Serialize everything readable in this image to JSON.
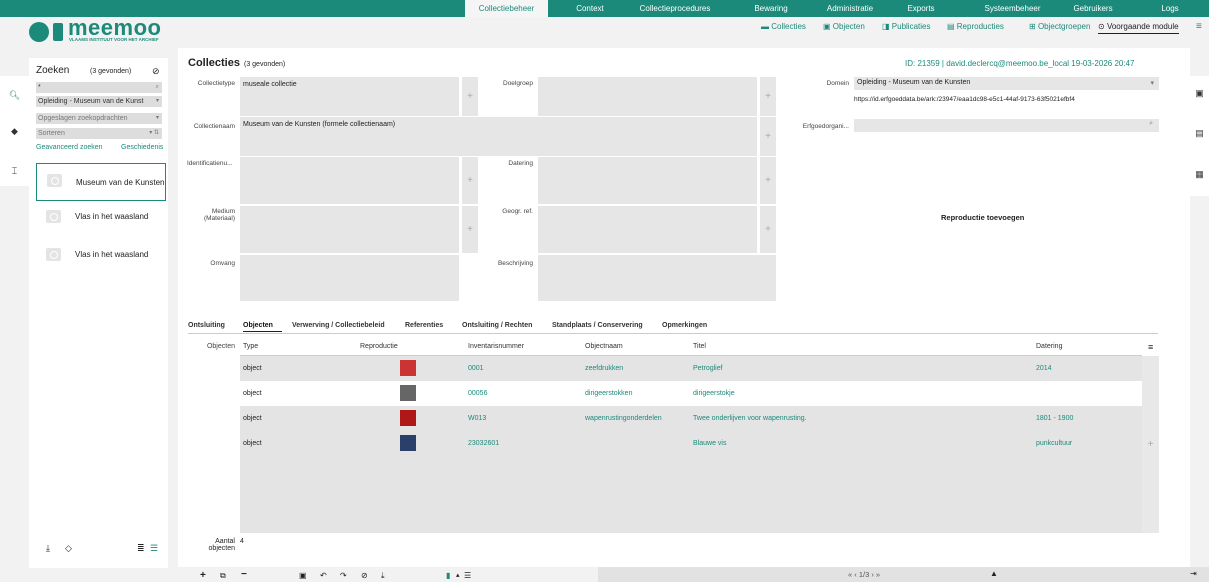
{
  "topnav": {
    "items": [
      "Collectiebeheer",
      "Context",
      "Collectieprocedures",
      "Bewaring",
      "Administratie",
      "Exports",
      "Systeembeheer",
      "Gebruikers",
      "Logs"
    ],
    "active": "Collectiebeheer"
  },
  "logo": {
    "name": "meemoo",
    "sub": "VLAAMS INSTITUUT VOOR HET ARCHIEF"
  },
  "subnav": {
    "items": [
      "Collecties",
      "Objecten",
      "Publicaties",
      "Reproducties",
      "Objectgroepen",
      "Voorgaande module"
    ],
    "active": "Voorgaande module"
  },
  "search": {
    "title": "Zoeken",
    "count": "(3 gevonden)",
    "query": "*",
    "filter": "Opleiding - Museum van de Kunst",
    "saved": "Opgeslagen zoekopdrachten",
    "sort": "Sorteren",
    "advanced": "Geavanceerd zoeken",
    "history": "Geschiedenis",
    "results": [
      "Museum van de Kunsten",
      "Vlas in het waasland",
      "Vlas in het waasland"
    ]
  },
  "record": {
    "title": "Collecties",
    "count": "(3 gevonden)",
    "meta": "ID: 21359 | david.declercq@meemoo.be_local 19-03-2026 20:47",
    "labels": {
      "collectietype": "Collectietype",
      "doelgroep": "Doelgroep",
      "domein": "Domein",
      "collectienaam": "Collectienaam",
      "erfgoed": "Erfgoedorgani...",
      "identificatie": "Identificatienu...",
      "datering": "Datering",
      "medium": "Medium (Materiaal)",
      "geogr": "Geogr. ref.",
      "omvang": "Omvang",
      "beschrijving": "Beschrijving"
    },
    "values": {
      "collectietype": "museale collectie",
      "collectienaam": "Museum van de Kunsten (formele collectienaam)",
      "domein": "Opleiding - Museum van de Kunsten",
      "domein_url": "https://id.erfgoeddata.be/ark:/23947/eaa1dc98-e5c1-44af-9173-63f5021efbf4"
    },
    "reproductie": "Reproductie toevoegen"
  },
  "tabs": [
    "Ontsluiting",
    "Objecten",
    "Verwerving / Collectiebeleid",
    "Referenties",
    "Ontsluiting / Rechten",
    "Standplaats / Conservering",
    "Opmerkingen"
  ],
  "objects": {
    "label": "Objecten",
    "columns": [
      "Type",
      "Reproductie",
      "Inventarisnummer",
      "Objectnaam",
      "Titel",
      "Datering"
    ],
    "rows": [
      {
        "type": "object",
        "inv": "0001",
        "naam": "zeefdrukken",
        "titel": "Petroglief",
        "datering": "2014",
        "thumb": "#c33"
      },
      {
        "type": "object",
        "inv": "00056",
        "naam": "dirigeerstokken",
        "titel": "dirigeerstokje",
        "datering": "",
        "thumb": "#666"
      },
      {
        "type": "object",
        "inv": "W013",
        "naam": "wapenrustingonderdelen",
        "titel": "Twee onderlijven voor wapenrusting.",
        "datering": "1801 - 1900",
        "thumb": "#b01818"
      },
      {
        "type": "object",
        "inv": "23032601",
        "naam": "",
        "titel": "Blauwe vis",
        "datering": "punkcultuur",
        "thumb": "#2b3f6b"
      }
    ],
    "aantal_label": "Aantal objecten",
    "aantal": "4"
  },
  "pager": "« ‹ 1/3 › »"
}
